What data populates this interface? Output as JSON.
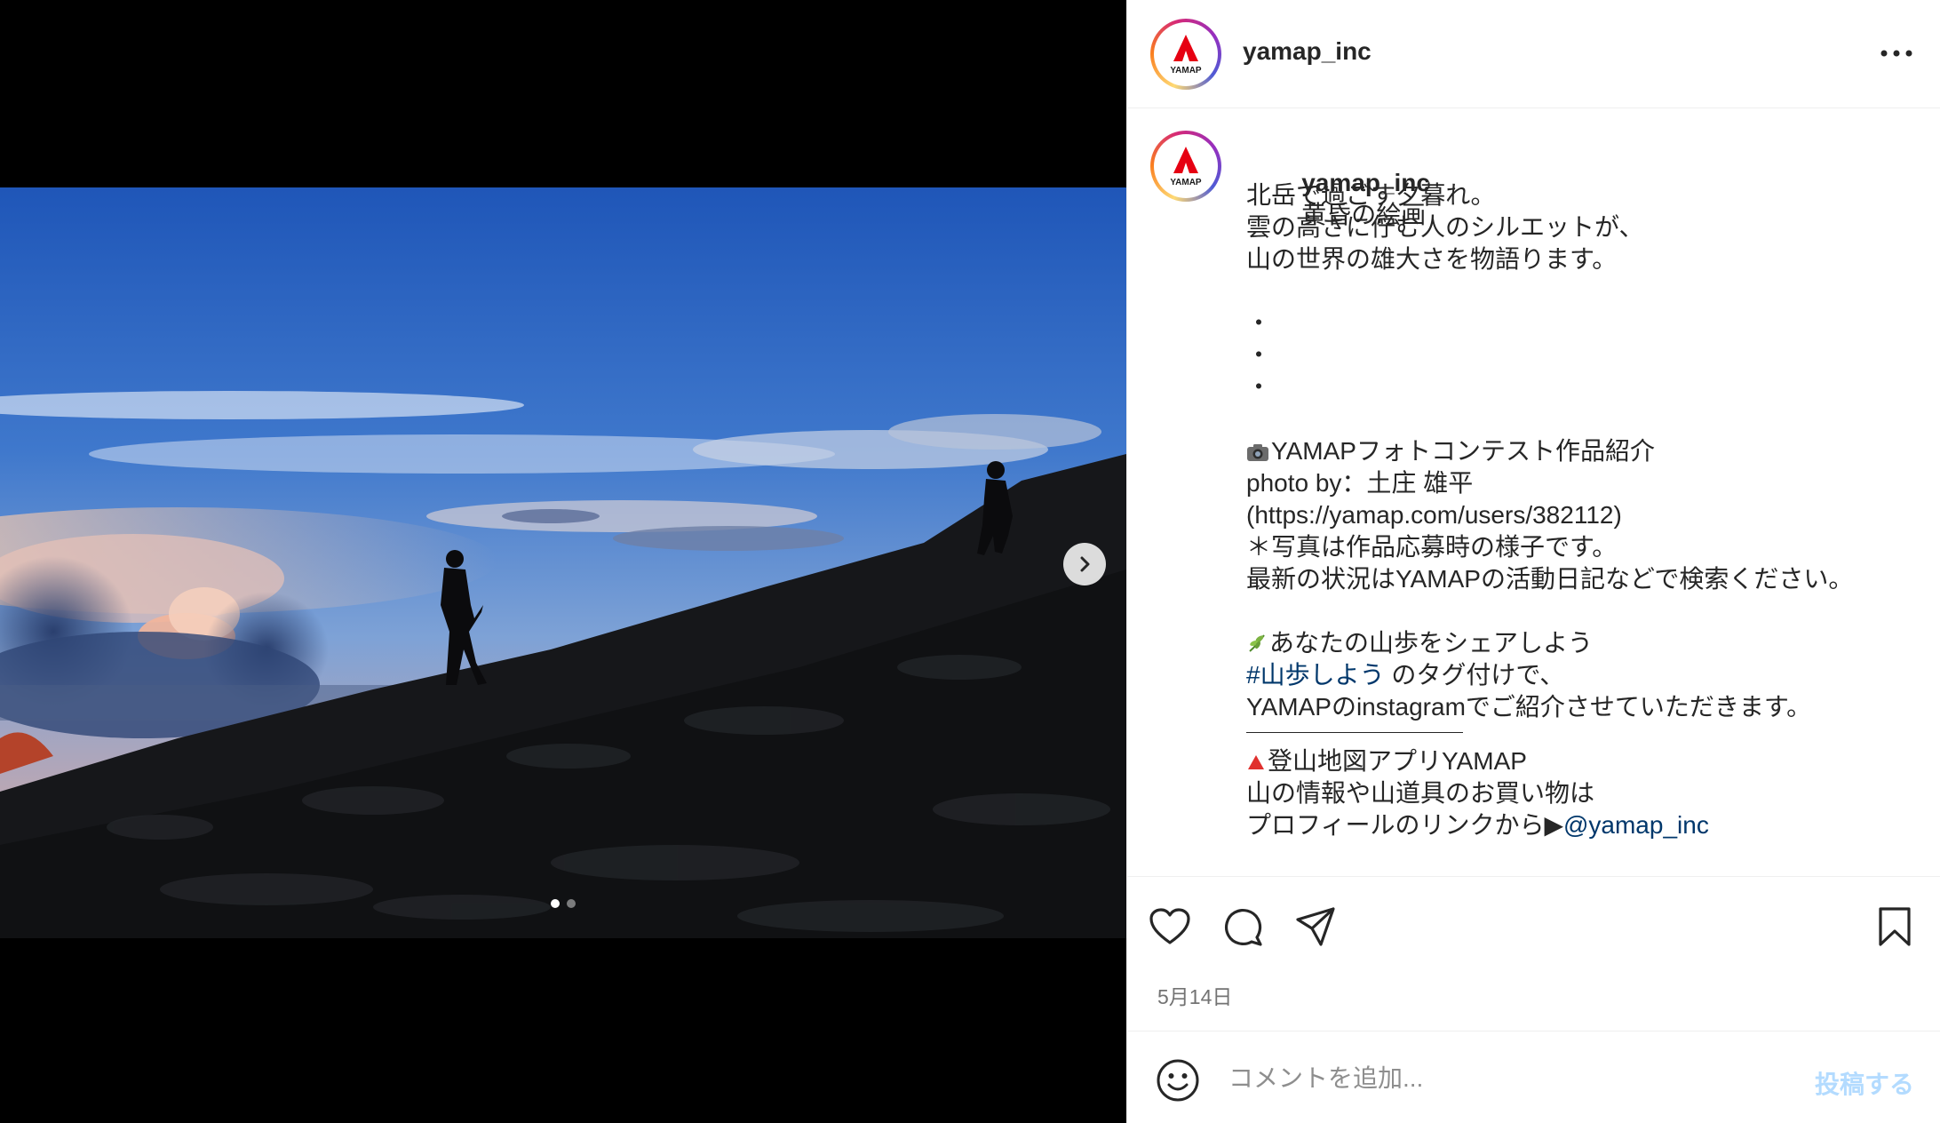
{
  "post": {
    "username": "yamap_inc",
    "avatar_label": "YAMAP",
    "caption_title": "黄昏の絵画",
    "caption_lines": [
      {
        "text": "北岳で過ごす夕暮れ。"
      },
      {
        "text": "雲の高さに佇む人のシルエットが、"
      },
      {
        "text": "山の世界の雄大さを物語ります。"
      },
      {
        "text": ""
      },
      {
        "text": "・"
      },
      {
        "text": "・"
      },
      {
        "text": "・"
      },
      {
        "text": ""
      },
      {
        "text": "YAMAPフォトコンテスト作品紹介",
        "icon": "camera-emoji-icon"
      },
      {
        "text": "photo by：土庄 雄平"
      },
      {
        "text": "(https://yamap.com/users/382112)"
      },
      {
        "text": "＊写真は作品応募時の様子です。"
      },
      {
        "text": "最新の状況はYAMAPの活動日記などで検索ください。"
      },
      {
        "text": ""
      },
      {
        "text": "あなたの山歩をシェアしよう",
        "icon": "herb-emoji-icon"
      },
      {
        "hashtag": "#山歩しよう",
        "text": " のタグ付けで、"
      },
      {
        "text": "YAMAPのinstagramでご紹介させていただきます。"
      },
      {
        "separator": true
      },
      {
        "text": "登山地図アプリYAMAP",
        "icon": "red-triangle-emoji-icon"
      },
      {
        "text": "山の情報や山道具のお買い物は"
      },
      {
        "text": "プロフィールのリンクから▶",
        "mention": "@yamap_inc"
      }
    ],
    "date": "5月14日",
    "carousel": {
      "total": 2,
      "current": 1
    }
  },
  "comment": {
    "placeholder": "コメントを追加...",
    "post_label": "投稿する"
  },
  "icons": {
    "like": "heart-icon",
    "comment": "comment-icon",
    "share": "share-icon",
    "save": "bookmark-icon",
    "more": "more-icon",
    "next": "chevron-right-icon",
    "emoji": "emoji-icon"
  },
  "colors": {
    "link": "#00376b",
    "post_button": "#b3dbff",
    "brand_red": "#e60012"
  }
}
